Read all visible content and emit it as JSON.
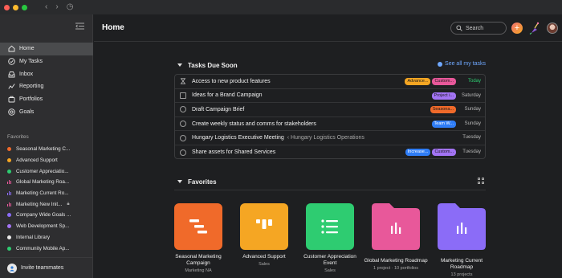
{
  "colors": {
    "accent": "#6fa8ff",
    "window_bg": "#1e1f21",
    "sidebar_bg": "#2e2e30"
  },
  "sidebar": {
    "nav": [
      {
        "label": "Home",
        "icon": "home-icon",
        "active": true
      },
      {
        "label": "My Tasks",
        "icon": "check-circle-icon"
      },
      {
        "label": "Inbox",
        "icon": "inbox-icon"
      },
      {
        "label": "Reporting",
        "icon": "reporting-icon"
      },
      {
        "label": "Portfolios",
        "icon": "portfolios-icon"
      },
      {
        "label": "Goals",
        "icon": "goals-icon"
      }
    ],
    "favorites_title": "Favorites",
    "favorites": [
      {
        "label": "Seasonal Marketing C...",
        "color": "#f06a2a",
        "kind": "dot"
      },
      {
        "label": "Advanced Support",
        "color": "#f5a623",
        "kind": "dot"
      },
      {
        "label": "Customer Appreciatio...",
        "color": "#2ecc71",
        "kind": "dot"
      },
      {
        "label": "Global Marketing Roa...",
        "color": "#e8589a",
        "kind": "bars"
      },
      {
        "label": "Marketing Current Ro...",
        "color": "#8b6cf7",
        "kind": "bars"
      },
      {
        "label": "Marketing New Init...",
        "color": "#e8589a",
        "kind": "bars",
        "locked": true
      },
      {
        "label": "Company Wide Goals ...",
        "color": "#8b6cf7",
        "kind": "dot"
      },
      {
        "label": "Web Development Sp...",
        "color": "#a374f4",
        "kind": "dot"
      },
      {
        "label": "Internal Library",
        "color": "#e8e8e8",
        "kind": "dot"
      },
      {
        "label": "Community Mobile Ap...",
        "color": "#2ecc71",
        "kind": "dot"
      }
    ],
    "invite_label": "Invite teammates"
  },
  "header": {
    "title": "Home",
    "search_placeholder": "Search",
    "add_label": "+"
  },
  "tasks": {
    "title": "Tasks Due Soon",
    "see_all": "See all my tasks",
    "rows": [
      {
        "name": "Access to new product features",
        "icon": "hourglass",
        "tags": [
          {
            "text": "Advance...",
            "color": "#f5a623"
          },
          {
            "text": "Custom...",
            "color": "#e8589a"
          }
        ],
        "due": "Today",
        "due_color": "#2ecc71"
      },
      {
        "name": "Ideas for a Brand Campaign",
        "icon": "approval",
        "tags": [
          {
            "text": "Project i...",
            "color": "#a374f4"
          }
        ],
        "due": "Saturday"
      },
      {
        "name": "Draft Campaign Brief",
        "icon": "check",
        "tags": [
          {
            "text": "Seasona...",
            "color": "#f06a2a"
          }
        ],
        "due": "Sunday"
      },
      {
        "name": "Create weekly status and comms for stakeholders",
        "icon": "check",
        "tags": [
          {
            "text": "Team W...",
            "color": "#2f7df6",
            "light": true
          }
        ],
        "due": "Sunday"
      },
      {
        "name": "Hungary Logistics Executive Meeting",
        "sub": "‹ Hungary Logistics Operations",
        "icon": "check",
        "tags": [],
        "due": "Tuesday"
      },
      {
        "name": "Share assets for Shared Services",
        "icon": "check",
        "tags": [
          {
            "text": "Increase...",
            "color": "#2f7df6",
            "light": true
          },
          {
            "text": "Custom...",
            "color": "#a374f4"
          }
        ],
        "due": "Tuesday"
      }
    ]
  },
  "favorites_section": {
    "title": "Favorites",
    "cards": [
      {
        "name": "Seasonal Marketing Campaign",
        "sub": "Marketing NA",
        "color": "#f06a2a",
        "icon": "timeline-icon"
      },
      {
        "name": "Advanced Support",
        "sub": "Sales",
        "color": "#f5a623",
        "icon": "board-icon"
      },
      {
        "name": "Customer Appreciation Event",
        "sub": "Sales",
        "color": "#2ecc71",
        "icon": "list-icon"
      },
      {
        "name": "Global Marketing Roadmap",
        "sub": "1 project · 10 portfolios",
        "color": "#e8589a",
        "icon": "portfolio-chart-icon"
      },
      {
        "name": "Marketing Current Roadmap",
        "sub": "13 projects",
        "color": "#8b6cf7",
        "icon": "portfolio-chart-icon"
      }
    ]
  }
}
